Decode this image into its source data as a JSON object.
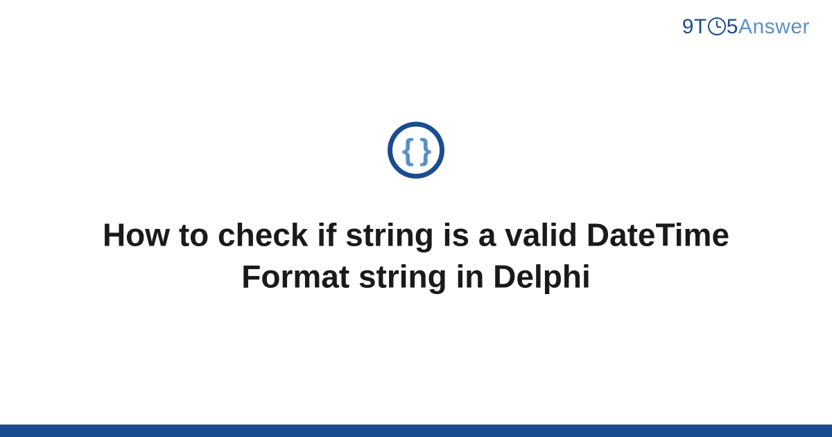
{
  "logo": {
    "part1": "9T",
    "part2": "5",
    "part3": "Answer"
  },
  "icon": {
    "braces": "{ }"
  },
  "title": "How to check if string is a valid DateTime Format string in Delphi"
}
